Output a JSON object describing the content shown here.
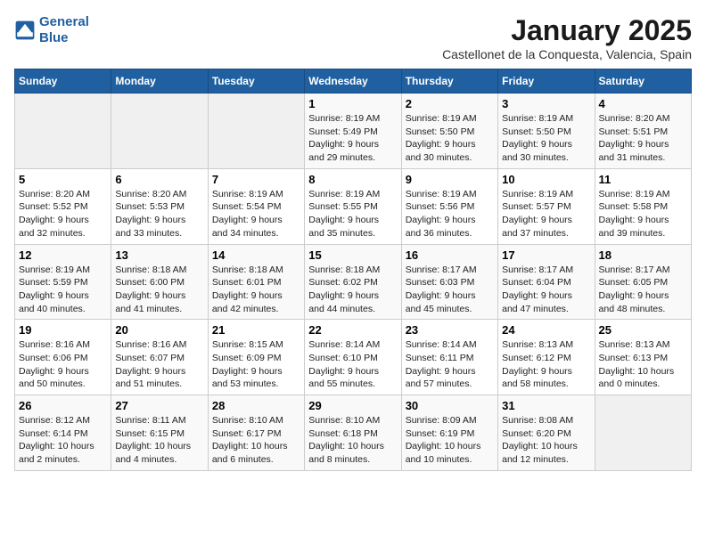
{
  "logo": {
    "line1": "General",
    "line2": "Blue"
  },
  "title": "January 2025",
  "subtitle": "Castellonet de la Conquesta, Valencia, Spain",
  "headers": [
    "Sunday",
    "Monday",
    "Tuesday",
    "Wednesday",
    "Thursday",
    "Friday",
    "Saturday"
  ],
  "weeks": [
    [
      {
        "day": "",
        "info": ""
      },
      {
        "day": "",
        "info": ""
      },
      {
        "day": "",
        "info": ""
      },
      {
        "day": "1",
        "info": "Sunrise: 8:19 AM\nSunset: 5:49 PM\nDaylight: 9 hours\nand 29 minutes."
      },
      {
        "day": "2",
        "info": "Sunrise: 8:19 AM\nSunset: 5:50 PM\nDaylight: 9 hours\nand 30 minutes."
      },
      {
        "day": "3",
        "info": "Sunrise: 8:19 AM\nSunset: 5:50 PM\nDaylight: 9 hours\nand 30 minutes."
      },
      {
        "day": "4",
        "info": "Sunrise: 8:20 AM\nSunset: 5:51 PM\nDaylight: 9 hours\nand 31 minutes."
      }
    ],
    [
      {
        "day": "5",
        "info": "Sunrise: 8:20 AM\nSunset: 5:52 PM\nDaylight: 9 hours\nand 32 minutes."
      },
      {
        "day": "6",
        "info": "Sunrise: 8:20 AM\nSunset: 5:53 PM\nDaylight: 9 hours\nand 33 minutes."
      },
      {
        "day": "7",
        "info": "Sunrise: 8:19 AM\nSunset: 5:54 PM\nDaylight: 9 hours\nand 34 minutes."
      },
      {
        "day": "8",
        "info": "Sunrise: 8:19 AM\nSunset: 5:55 PM\nDaylight: 9 hours\nand 35 minutes."
      },
      {
        "day": "9",
        "info": "Sunrise: 8:19 AM\nSunset: 5:56 PM\nDaylight: 9 hours\nand 36 minutes."
      },
      {
        "day": "10",
        "info": "Sunrise: 8:19 AM\nSunset: 5:57 PM\nDaylight: 9 hours\nand 37 minutes."
      },
      {
        "day": "11",
        "info": "Sunrise: 8:19 AM\nSunset: 5:58 PM\nDaylight: 9 hours\nand 39 minutes."
      }
    ],
    [
      {
        "day": "12",
        "info": "Sunrise: 8:19 AM\nSunset: 5:59 PM\nDaylight: 9 hours\nand 40 minutes."
      },
      {
        "day": "13",
        "info": "Sunrise: 8:18 AM\nSunset: 6:00 PM\nDaylight: 9 hours\nand 41 minutes."
      },
      {
        "day": "14",
        "info": "Sunrise: 8:18 AM\nSunset: 6:01 PM\nDaylight: 9 hours\nand 42 minutes."
      },
      {
        "day": "15",
        "info": "Sunrise: 8:18 AM\nSunset: 6:02 PM\nDaylight: 9 hours\nand 44 minutes."
      },
      {
        "day": "16",
        "info": "Sunrise: 8:17 AM\nSunset: 6:03 PM\nDaylight: 9 hours\nand 45 minutes."
      },
      {
        "day": "17",
        "info": "Sunrise: 8:17 AM\nSunset: 6:04 PM\nDaylight: 9 hours\nand 47 minutes."
      },
      {
        "day": "18",
        "info": "Sunrise: 8:17 AM\nSunset: 6:05 PM\nDaylight: 9 hours\nand 48 minutes."
      }
    ],
    [
      {
        "day": "19",
        "info": "Sunrise: 8:16 AM\nSunset: 6:06 PM\nDaylight: 9 hours\nand 50 minutes."
      },
      {
        "day": "20",
        "info": "Sunrise: 8:16 AM\nSunset: 6:07 PM\nDaylight: 9 hours\nand 51 minutes."
      },
      {
        "day": "21",
        "info": "Sunrise: 8:15 AM\nSunset: 6:09 PM\nDaylight: 9 hours\nand 53 minutes."
      },
      {
        "day": "22",
        "info": "Sunrise: 8:14 AM\nSunset: 6:10 PM\nDaylight: 9 hours\nand 55 minutes."
      },
      {
        "day": "23",
        "info": "Sunrise: 8:14 AM\nSunset: 6:11 PM\nDaylight: 9 hours\nand 57 minutes."
      },
      {
        "day": "24",
        "info": "Sunrise: 8:13 AM\nSunset: 6:12 PM\nDaylight: 9 hours\nand 58 minutes."
      },
      {
        "day": "25",
        "info": "Sunrise: 8:13 AM\nSunset: 6:13 PM\nDaylight: 10 hours\nand 0 minutes."
      }
    ],
    [
      {
        "day": "26",
        "info": "Sunrise: 8:12 AM\nSunset: 6:14 PM\nDaylight: 10 hours\nand 2 minutes."
      },
      {
        "day": "27",
        "info": "Sunrise: 8:11 AM\nSunset: 6:15 PM\nDaylight: 10 hours\nand 4 minutes."
      },
      {
        "day": "28",
        "info": "Sunrise: 8:10 AM\nSunset: 6:17 PM\nDaylight: 10 hours\nand 6 minutes."
      },
      {
        "day": "29",
        "info": "Sunrise: 8:10 AM\nSunset: 6:18 PM\nDaylight: 10 hours\nand 8 minutes."
      },
      {
        "day": "30",
        "info": "Sunrise: 8:09 AM\nSunset: 6:19 PM\nDaylight: 10 hours\nand 10 minutes."
      },
      {
        "day": "31",
        "info": "Sunrise: 8:08 AM\nSunset: 6:20 PM\nDaylight: 10 hours\nand 12 minutes."
      },
      {
        "day": "",
        "info": ""
      }
    ]
  ]
}
